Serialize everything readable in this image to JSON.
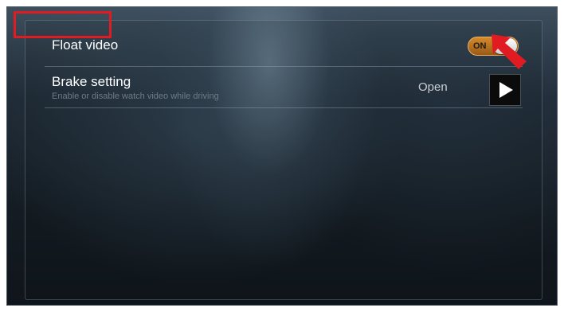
{
  "settings": {
    "float_video": {
      "label": "Float video",
      "toggle_text": "ON",
      "toggle_state": "on"
    },
    "brake_setting": {
      "label": "Brake setting",
      "description": "Enable or disable watch video while driving",
      "value": "Open",
      "action_icon": "play-icon"
    }
  },
  "annotations": {
    "highlight_color": "#e11b22",
    "arrow_icon": "pointer-arrow-icon"
  },
  "colors": {
    "toggle_on": "#c97a22",
    "text_primary": "#ffffff",
    "text_secondary": "#6f7b86"
  }
}
